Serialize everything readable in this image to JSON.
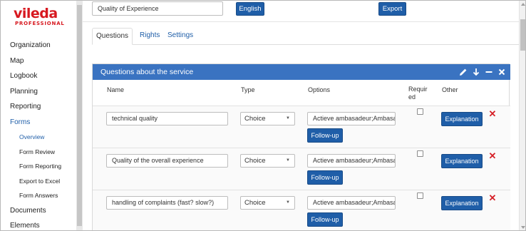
{
  "logo": {
    "brand": "vileda",
    "sub": "PROFESSIONAL"
  },
  "sidebar": {
    "items": [
      {
        "label": "Organization"
      },
      {
        "label": "Map"
      },
      {
        "label": "Logbook"
      },
      {
        "label": "Planning"
      },
      {
        "label": "Reporting"
      },
      {
        "label": "Forms"
      }
    ],
    "sub_items": [
      {
        "label": "Overview"
      },
      {
        "label": "Form Review"
      },
      {
        "label": "Form Reporting"
      },
      {
        "label": "Export to Excel"
      },
      {
        "label": "Form Answers"
      }
    ],
    "bottom_items": [
      {
        "label": "Documents"
      },
      {
        "label": "Elements"
      }
    ]
  },
  "toolbar": {
    "form_name_value": "Quality of Experience",
    "language_label": "English",
    "export_label": "Export"
  },
  "tabs": [
    {
      "label": "Questions"
    },
    {
      "label": "Rights"
    },
    {
      "label": "Settings"
    }
  ],
  "panel": {
    "title": "Questions about the service",
    "columns": {
      "name": "Name",
      "type": "Type",
      "options": "Options",
      "required": "Requir ed",
      "other": "Other"
    },
    "rows": [
      {
        "name": "technical quality",
        "type": "Choice",
        "options": "Actieve ambasadeur;Ambasadeur",
        "required": false,
        "followup_label": "Follow-up",
        "explanation_label": "Explanation"
      },
      {
        "name": "Quality of the overall experience",
        "type": "Choice",
        "options": "Actieve ambasadeur;Ambasadeur",
        "required": false,
        "followup_label": "Follow-up",
        "explanation_label": "Explanation"
      },
      {
        "name": "handling of complaints  (fast? slow?)",
        "type": "Choice",
        "options": "Actieve ambasadeur;Ambasadeur",
        "required": false,
        "followup_label": "Follow-up",
        "explanation_label": "Explanation"
      }
    ]
  },
  "colors": {
    "brand_red": "#d71920",
    "primary_blue": "#1f5ea8",
    "panel_header_blue": "#3a73c1",
    "delete_red": "#d61f26"
  }
}
